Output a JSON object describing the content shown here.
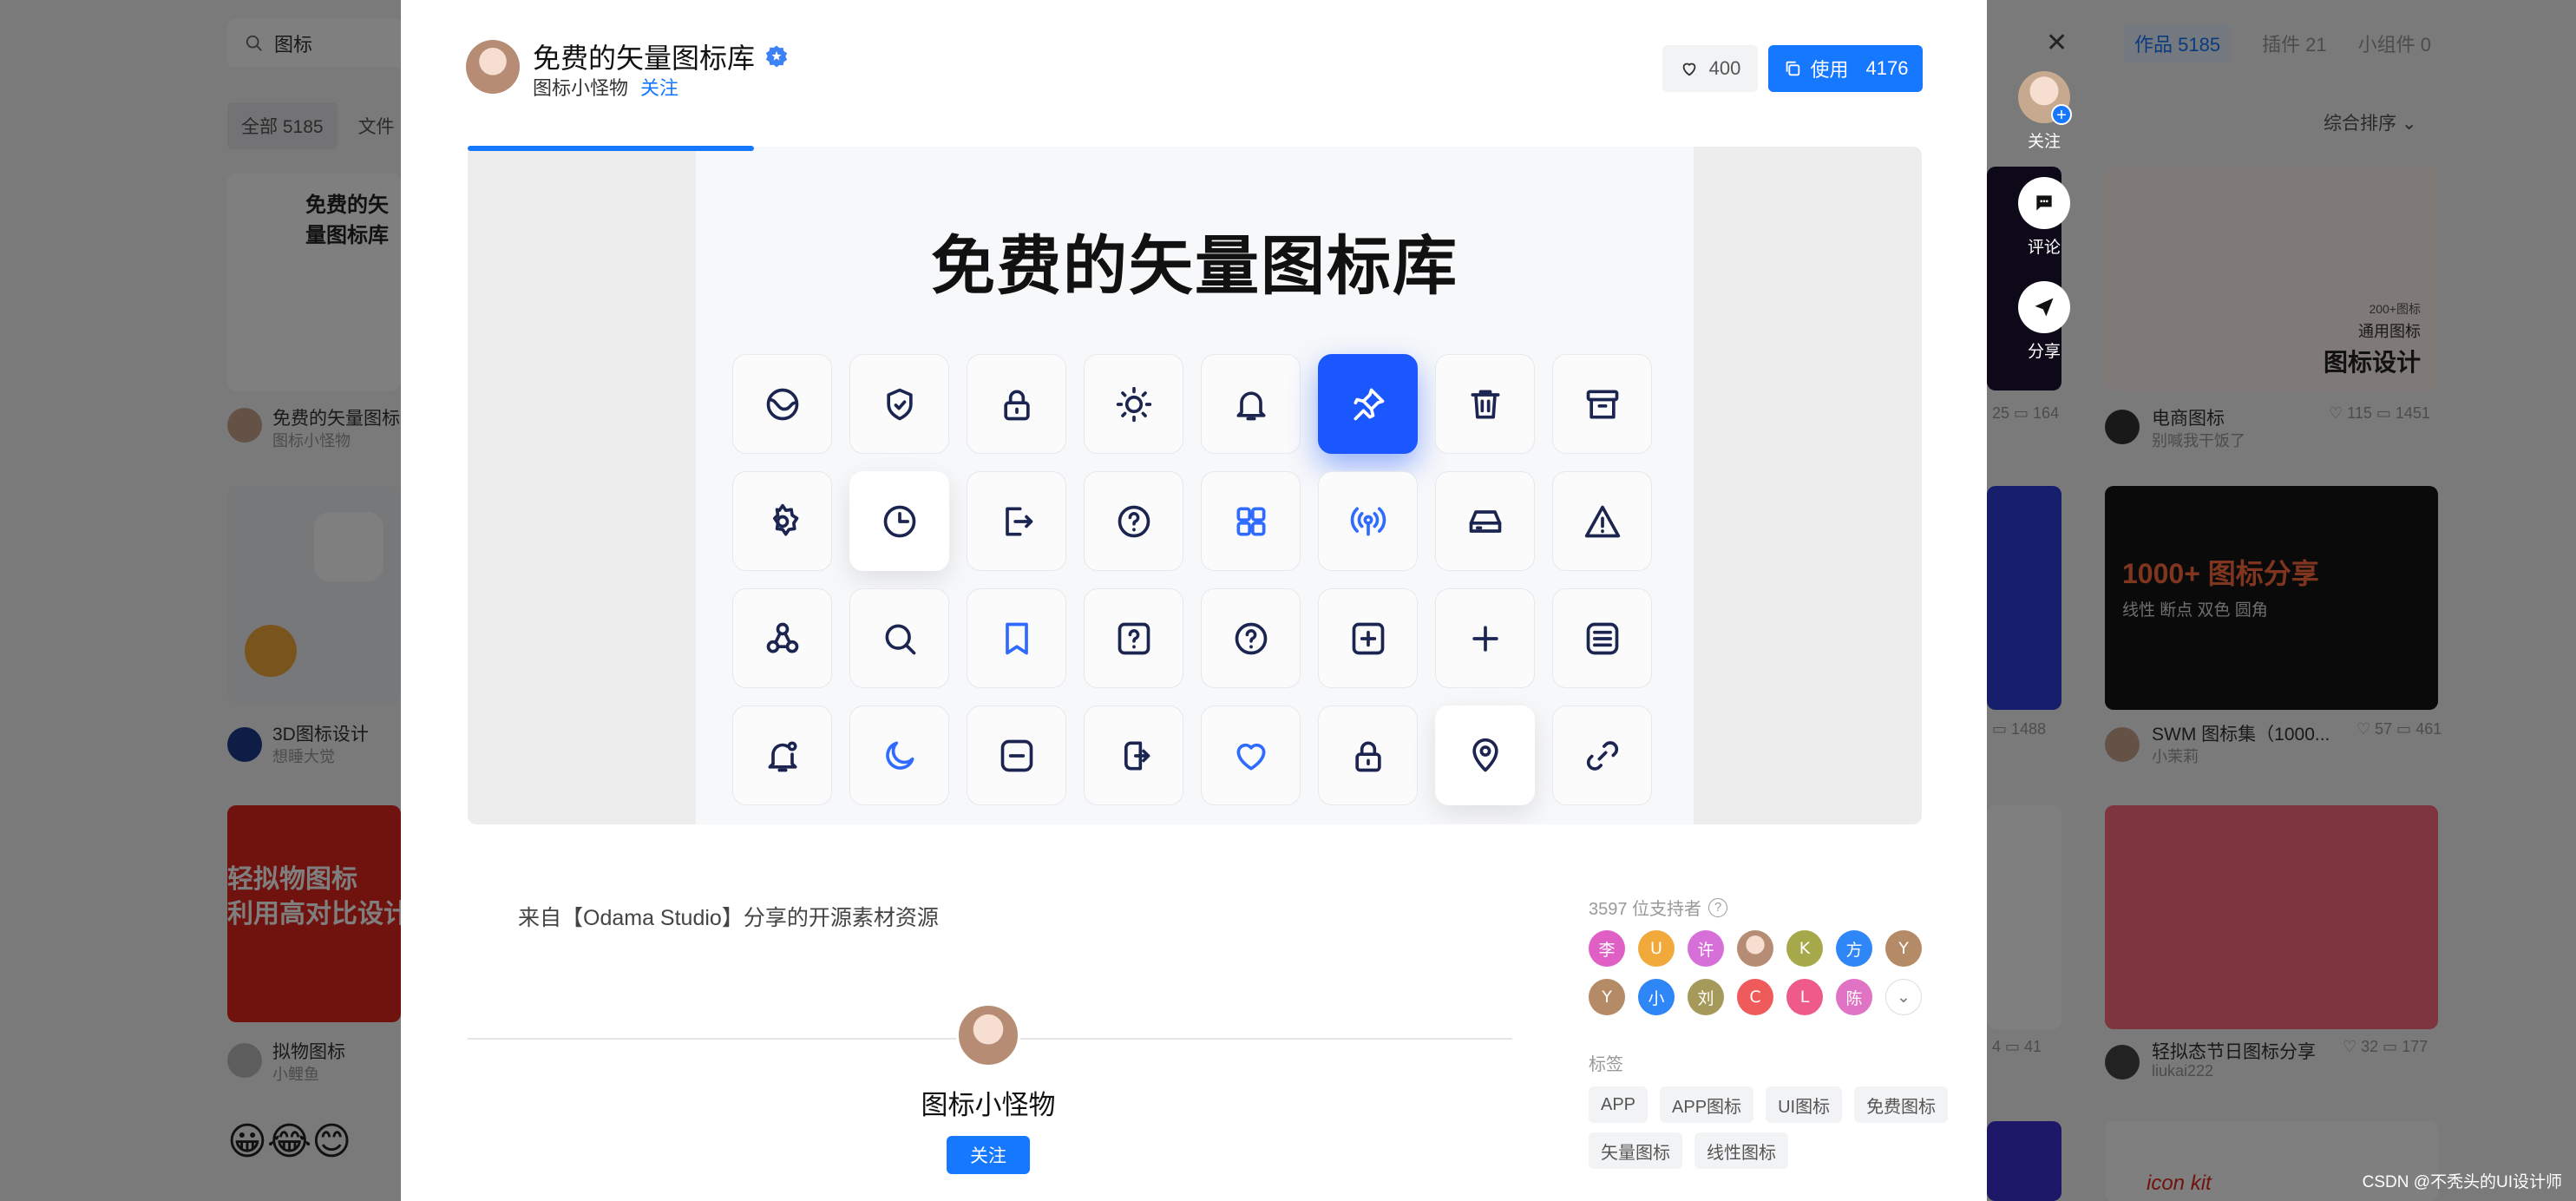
{
  "background": {
    "search_value": "图标",
    "filters": [
      "全部 5185",
      "文件"
    ],
    "right_tabs": [
      "作品 5185",
      "插件 21",
      "小组件 0"
    ],
    "sort_label": "综合排序",
    "cards": [
      {
        "title": "免费的矢量图标库",
        "author": "图标小怪物"
      },
      {
        "title": "3D图标设计",
        "author": "想睡大觉"
      },
      {
        "title": "拟物图标",
        "author": "小鲤鱼"
      },
      {
        "title": "电商图标",
        "author": "别喊我干饭了",
        "likes": "115",
        "comments": "1451"
      },
      {
        "title": "SWM 图标集（1000...",
        "author": "小茉莉",
        "likes": "57",
        "comments": "461"
      },
      {
        "title": "轻拟态节日图标分享",
        "author": "liukai222",
        "likes": "32",
        "comments": "177"
      }
    ],
    "mid_stats": [
      "25",
      "164",
      "1488",
      "4",
      "41"
    ],
    "card_texts": {
      "skeu_line1": "轻拟物图标",
      "skeu_line2": "利用高对比设计",
      "icon_design_small1": "200+图标",
      "icon_design_small2": "通用图标",
      "icon_design_big": "图标设计",
      "swm_big": "1000+ 图标分享",
      "swm_sub": "线性 断点 双色 圆角",
      "iconkit": "icon kit"
    }
  },
  "side_actions": {
    "follow_label": "关注",
    "comment_label": "评论",
    "share_label": "分享"
  },
  "modal": {
    "title": "免费的矢量图标库",
    "author": "图标小怪物",
    "follow_link": "关注",
    "like_count": "400",
    "use_label": "使用",
    "use_count": "4176",
    "preview_title": "免费的矢量图标库",
    "description": "来自【Odama Studio】分享的开源素材资源",
    "author_name": "图标小怪物",
    "author_follow": "关注",
    "supporters_label": "3597 位支持者",
    "supporters_row1": [
      {
        "char": "李",
        "color": "#e05fc5"
      },
      {
        "char": "U",
        "color": "#f2a93b"
      },
      {
        "char": "许",
        "color": "#d76fd8"
      },
      {
        "char": "",
        "color": "#c9a58f"
      },
      {
        "char": "K",
        "color": "#a6a84a"
      },
      {
        "char": "方",
        "color": "#2f86f6"
      },
      {
        "char": "Y",
        "color": "#b58a67"
      }
    ],
    "supporters_row2": [
      {
        "char": "Y",
        "color": "#b58a67"
      },
      {
        "char": "小",
        "color": "#2f86f6"
      },
      {
        "char": "刘",
        "color": "#a59a5a"
      },
      {
        "char": "C",
        "color": "#ef5b5b"
      },
      {
        "char": "L",
        "color": "#ef5b88"
      },
      {
        "char": "陈",
        "color": "#e073c4"
      }
    ],
    "tags_label": "标签",
    "tags_row1": [
      "APP",
      "APP图标",
      "UI图标",
      "免费图标"
    ],
    "tags_row2": [
      "矢量图标",
      "线性图标"
    ],
    "icons": [
      "planet-icon",
      "shield-icon",
      "lock-icon",
      "sun-icon",
      "bell-icon",
      "pin-icon",
      "trash-icon",
      "archive-icon",
      "settings-icon",
      "clock-icon",
      "logout-icon",
      "help-circle-icon",
      "grid-icon",
      "broadcast-icon",
      "drive-icon",
      "warning-icon",
      "triangle-nodes-icon",
      "search-icon",
      "bookmark-icon",
      "help-square-icon",
      "help-circle-icon",
      "plus-square-icon",
      "plus-icon",
      "list-icon",
      "bell-notify-icon",
      "moon-icon",
      "minus-square-icon",
      "login-icon",
      "heart-icon",
      "lock-icon",
      "location-icon",
      "link-icon"
    ]
  },
  "watermark": "CSDN @不秃头的UI设计师",
  "colors": {
    "accent": "#1677ff",
    "active_tile": "#1a57ff",
    "icon_stroke": "#1b2550"
  }
}
